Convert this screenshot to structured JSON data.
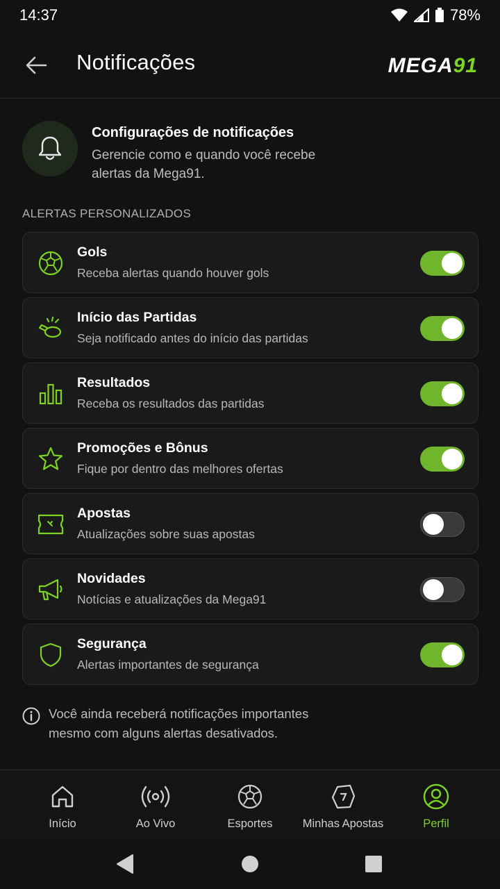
{
  "status": {
    "time": "14:37",
    "battery": "78%"
  },
  "appbar": {
    "title": "Notificações",
    "logo_part1": "MEGA",
    "logo_part2": "91"
  },
  "intro": {
    "title": "Configurações de notificações",
    "description": "Gerencie como e quando você recebe alertas da Mega91."
  },
  "section_title": "ALERTAS PERSONALIZADOS",
  "alerts": [
    {
      "icon": "soccer-ball-icon",
      "title": "Gols",
      "description": "Receba alertas quando houver gols",
      "enabled": true
    },
    {
      "icon": "whistle-icon",
      "title": "Início das Partidas",
      "description": "Seja notificado antes do início das partidas",
      "enabled": true
    },
    {
      "icon": "bar-chart-icon",
      "title": "Resultados",
      "description": "Receba os resultados das partidas",
      "enabled": true
    },
    {
      "icon": "star-icon",
      "title": "Promoções e Bônus",
      "description": "Fique por dentro das melhores ofertas",
      "enabled": true
    },
    {
      "icon": "ticket-icon",
      "title": "Apostas",
      "description": "Atualizações sobre suas apostas",
      "enabled": false
    },
    {
      "icon": "megaphone-icon",
      "title": "Novidades",
      "description": "Notícias e atualizações da Mega91",
      "enabled": false
    },
    {
      "icon": "shield-icon",
      "title": "Segurança",
      "description": "Alertas importantes de segurança",
      "enabled": true
    }
  ],
  "info_text": "Você ainda receberá notificações importantes mesmo com alguns alertas desativados.",
  "nav": [
    {
      "icon": "home-icon",
      "label": "Início",
      "active": false
    },
    {
      "icon": "live-icon",
      "label": "Ao Vivo",
      "active": false
    },
    {
      "icon": "soccer-ball-icon",
      "label": "Esportes",
      "active": false
    },
    {
      "icon": "bets-icon",
      "label": "Minhas Apostas",
      "active": false
    },
    {
      "icon": "profile-icon",
      "label": "Perfil",
      "active": true
    }
  ],
  "colors": {
    "accent": "#7ed321",
    "toggle_on": "#6fb62c",
    "background": "#121212",
    "card": "#1a1a1a"
  }
}
